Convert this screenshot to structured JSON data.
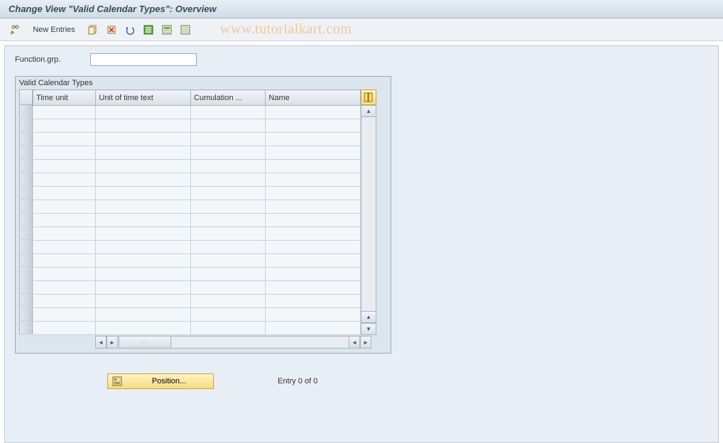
{
  "title": "Change View \"Valid Calendar Types\": Overview",
  "watermark": "www.tutorialkart.com",
  "toolbar": {
    "new_entries": "New Entries"
  },
  "field": {
    "function_grp_label": "Function.grp.",
    "function_grp_value": ""
  },
  "group": {
    "title": "Valid Calendar Types"
  },
  "columns": {
    "time_unit": "Time unit",
    "unit_text": "Unit of time text",
    "cumulation": "Cumulation ...",
    "name": "Name"
  },
  "footer": {
    "position_btn": "Position...",
    "entry_info": "Entry 0 of 0"
  },
  "icons": {
    "edit": "edit-icon",
    "copy": "copy-icon",
    "save_yellow": "save-yellow-icon",
    "undo": "undo-icon",
    "select_all": "select-all-icon",
    "select_block": "select-block-icon",
    "deselect": "deselect-icon",
    "config": "config-columns-icon",
    "position": "position-icon"
  }
}
